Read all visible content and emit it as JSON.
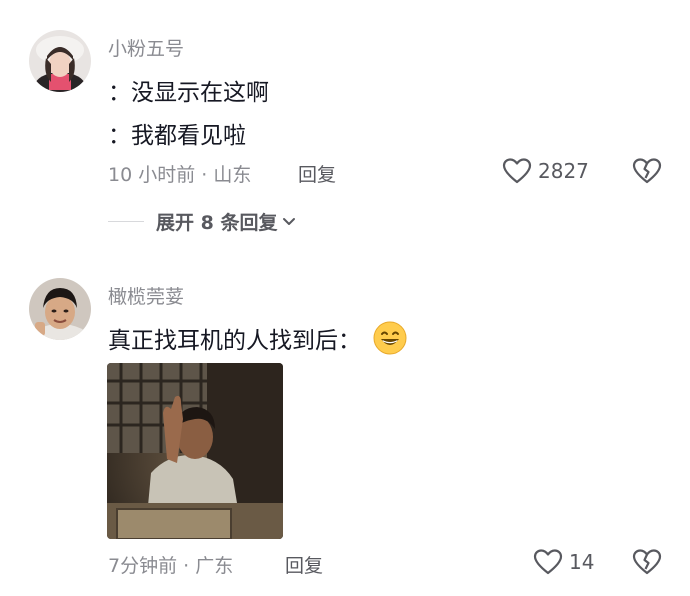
{
  "comments": [
    {
      "username": "小粉五号",
      "lines": [
        "：没显示在这啊",
        "：我都看见啦"
      ],
      "meta": "10 小时前 · 山东",
      "reply_label": "回复",
      "likes": "2827",
      "expand_label": "展开 8 条回复"
    },
    {
      "username": "橄榄莞荽",
      "text": "真正找耳机的人找到后：",
      "meta": "7分钟前 · 广东",
      "reply_label": "回复",
      "likes": "14"
    }
  ],
  "icons": {
    "heart": "heart-icon",
    "dislike": "broken-heart-icon",
    "chevron": "chevron-down-icon",
    "emoji": "grinning-face-emoji"
  },
  "colors": {
    "text_primary": "#161823",
    "text_secondary": "#8a8b91",
    "text_action": "#58595f"
  }
}
